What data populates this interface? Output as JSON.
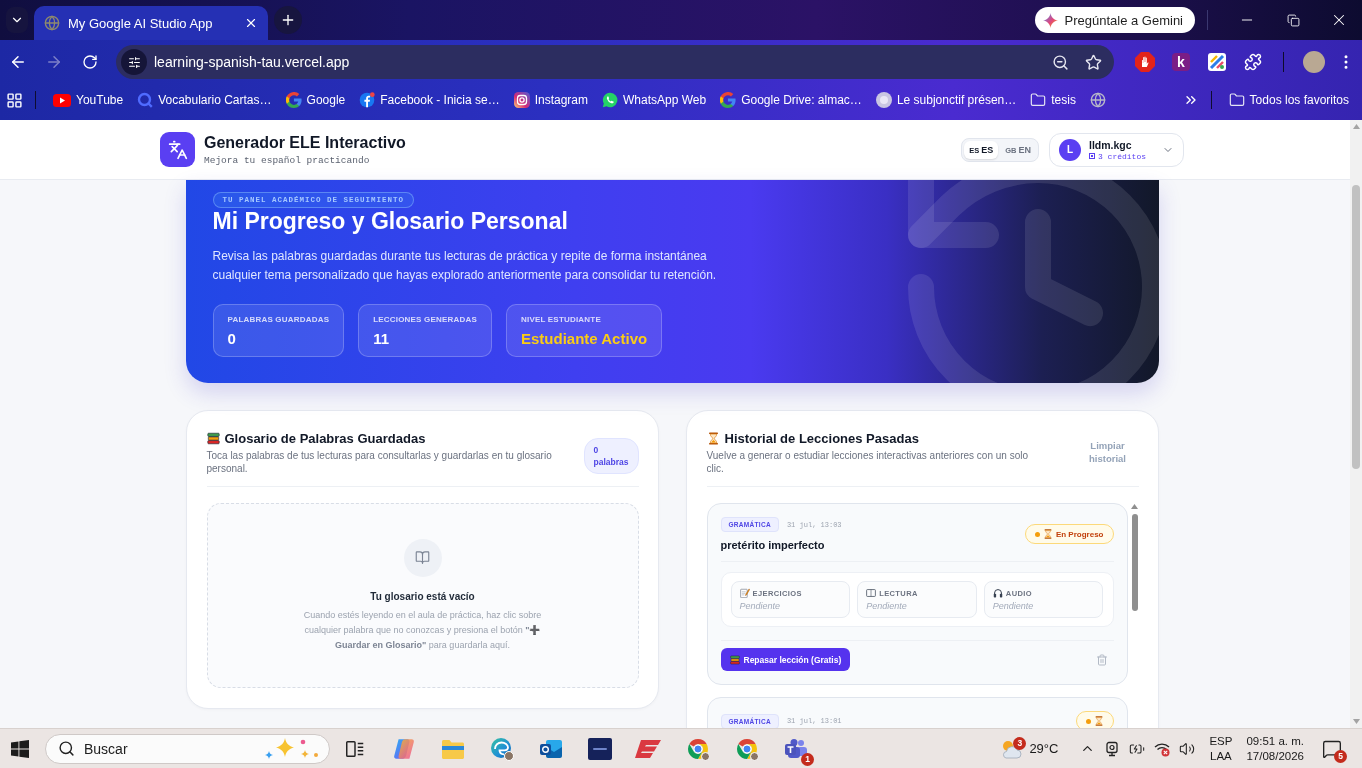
{
  "browser": {
    "tabs": [
      {
        "title": "My Google AI Studio App",
        "selected": true
      }
    ],
    "gemini_button": "Pregúntale a Gemini",
    "address": "learning-spanish-tau.vercel.app",
    "extension_label": "k",
    "bookmarks": [
      {
        "kind": "youtube",
        "label": "YouTube"
      },
      {
        "kind": "quizlet",
        "label": "Vocabulario Cartas…"
      },
      {
        "kind": "google",
        "label": "Google"
      },
      {
        "kind": "facebook",
        "label": "Facebook - Inicia se…"
      },
      {
        "kind": "instagram",
        "label": "Instagram"
      },
      {
        "kind": "whatsapp",
        "label": "WhatsApp Web"
      },
      {
        "kind": "google",
        "label": "Google Drive: almac…"
      },
      {
        "kind": "site",
        "label": "Le subjonctif présen…"
      },
      {
        "kind": "folder",
        "label": "tesis"
      },
      {
        "kind": "globe"
      }
    ],
    "all_bookmarks": "Todos los favoritos"
  },
  "app": {
    "header": {
      "title": "Generador ELE Interactivo",
      "subtitle": "Mejora tu español practicando",
      "languages": [
        {
          "flag": "ES",
          "code": "ES",
          "selected": true
        },
        {
          "flag": "GB",
          "code": "EN",
          "selected": false
        }
      ],
      "user": {
        "initial": "L",
        "name": "lldm.kgc",
        "credits": "3 créditos"
      }
    },
    "hero": {
      "badge": "TU PANEL ACADÉMICO DE SEGUIMIENTO",
      "title": "Mi Progreso y Glosario Personal",
      "description": "Revisa las palabras guardadas durante tus lecturas de práctica y repite de forma instantánea cualquier tema personalizado que hayas explorado anteriormente para consolidar tu retención.",
      "stats": [
        {
          "kind": "plain",
          "label": "PALABRAS GUARDADAS",
          "value": "0"
        },
        {
          "kind": "plain",
          "label": "LECCIONES GENERADAS",
          "value": "11"
        },
        {
          "kind": "highlight",
          "label": "NIVEL ESTUDIANTE",
          "value": "Estudiante Activo"
        }
      ]
    },
    "glossary": {
      "title": "Glosario de Palabras Guardadas",
      "subtitle": "Toca las palabras de tus lecturas para consultarlas y guardarlas en tu glosario personal.",
      "count": "0 palabras",
      "empty_title": "Tu glosario está vacío",
      "empty_text": "Cuando estés leyendo en el aula de práctica, haz clic sobre cualquier palabra que no conozcas y presiona el botón **\"➕ Guardar en Glosario\"** para guardarla aquí."
    },
    "history": {
      "title": "Historial de Lecciones Pasadas",
      "subtitle": "Vuelve a generar o estudiar lecciones interactivas anteriores con un solo clic.",
      "clear_button": "Limpiar historial",
      "lessons": [
        {
          "tag": "GRAMÁTICA",
          "date": "31 jul, 13:03",
          "title": "pretérito imperfecto",
          "status": {
            "kind": "in_progress",
            "label": "En Progreso"
          },
          "progress": [
            {
              "kind": "exercises",
              "label": "EJERCICIOS",
              "state": "Pendiente"
            },
            {
              "kind": "reading",
              "label": "LECTURA",
              "state": "Pendiente"
            },
            {
              "kind": "audio",
              "label": "AUDIO",
              "state": "Pendiente"
            }
          ],
          "action": "Repasar lección (Gratis)"
        },
        {
          "tag": "GRAMÁTICA",
          "date": "31 jul, 13:01",
          "status": {
            "kind": "in_progress"
          }
        }
      ]
    }
  },
  "taskbar": {
    "search": {
      "placeholder": "Buscar"
    },
    "weather": {
      "badge": "3",
      "temperature": "29°C"
    },
    "chat_badge": "1",
    "input_language": "ESP",
    "keyboard_layout": "LAA",
    "time": "09:51 a. m.",
    "date": "17/08/2026",
    "notifications": "5"
  }
}
